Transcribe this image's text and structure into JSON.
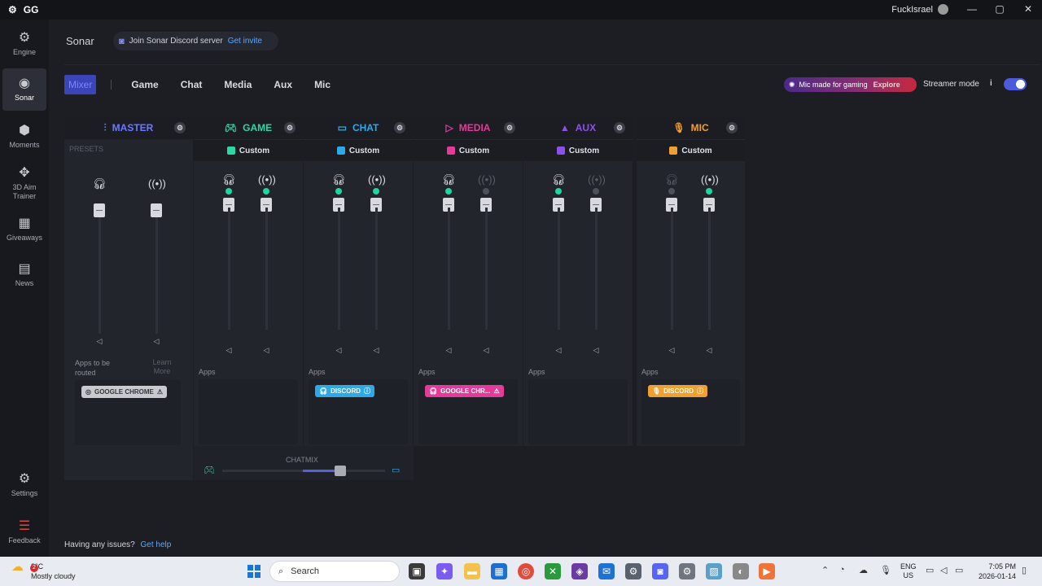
{
  "app": {
    "logo_text": "GG",
    "user_name": "FuckIsrael"
  },
  "window_controls": {
    "minimize": "—",
    "maximize": "▢",
    "close": "✕"
  },
  "sidebar": {
    "items": [
      {
        "label": "Engine",
        "icon": "chip-icon",
        "glyph": "⚙"
      },
      {
        "label": "Sonar",
        "icon": "sonar-icon",
        "glyph": "◉"
      },
      {
        "label": "Moments",
        "icon": "moments-icon",
        "glyph": "⬢"
      },
      {
        "label": "3D Aim Trainer",
        "icon": "aim-trainer-icon",
        "glyph": "✥"
      },
      {
        "label": "Giveaways",
        "icon": "gift-icon",
        "glyph": "▦"
      },
      {
        "label": "News",
        "icon": "news-icon",
        "glyph": "▤"
      },
      {
        "label": "Settings",
        "icon": "gear-icon",
        "glyph": "⚙"
      },
      {
        "label": "Feedback",
        "icon": "feedback-icon",
        "glyph": "☰"
      }
    ]
  },
  "header": {
    "title": "Sonar",
    "discord_text": "Join Sonar Discord server",
    "discord_link": "Get invite",
    "tabs": [
      "Mixer",
      "Game",
      "Chat",
      "Media",
      "Aux",
      "Mic"
    ],
    "active_tab": "Mixer",
    "mic_promo_text": "Mic made for gaming",
    "mic_promo_link": "Explore",
    "streamer_mode_label": "Streamer mode",
    "info": "i",
    "streamer_mode_on": true
  },
  "colors": {
    "accent": "#4c5bdc",
    "master": "#6b78ff",
    "game": "#2ed6a4",
    "chat": "#2fa8e8",
    "media": "#e33b9a",
    "aux": "#8a52e8",
    "mic": "#f0a030",
    "active_dot": "#20d6a0"
  },
  "mixer": {
    "master": {
      "title": "MASTER",
      "presets_label": "PRESETS",
      "apps_routed_label": "Apps to be routed",
      "learn_more": "Learn More",
      "app_chip": "GOOGLE CHROME"
    },
    "columns": [
      {
        "key": "game",
        "title": "GAME",
        "preset": "Custom",
        "apps_label": "Apps",
        "app_chip": ""
      },
      {
        "key": "chat",
        "title": "CHAT",
        "preset": "Custom",
        "apps_label": "Apps",
        "app_chip": "DISCORD"
      },
      {
        "key": "media",
        "title": "MEDIA",
        "preset": "Custom",
        "apps_label": "Apps",
        "app_chip": "GOOGLE CHR..."
      },
      {
        "key": "aux",
        "title": "AUX",
        "preset": "Custom",
        "apps_label": "Apps",
        "app_chip": ""
      },
      {
        "key": "mic",
        "title": "MIC",
        "preset": "Custom",
        "apps_label": "Apps",
        "app_chip": "DISCORD"
      }
    ],
    "chatmix_label": "CHATMIX",
    "chatmix_value": 0.72
  },
  "footer": {
    "issues_text": "Having any issues?",
    "help_link": "Get help"
  },
  "taskbar": {
    "weather_temp": "8°C",
    "weather_desc": "Mostly cloudy",
    "weather_badge": "2",
    "search_placeholder": "Search",
    "lang_line1": "ENG",
    "lang_line2": "US",
    "time": "7:05 PM",
    "date": "2026-01-14"
  }
}
